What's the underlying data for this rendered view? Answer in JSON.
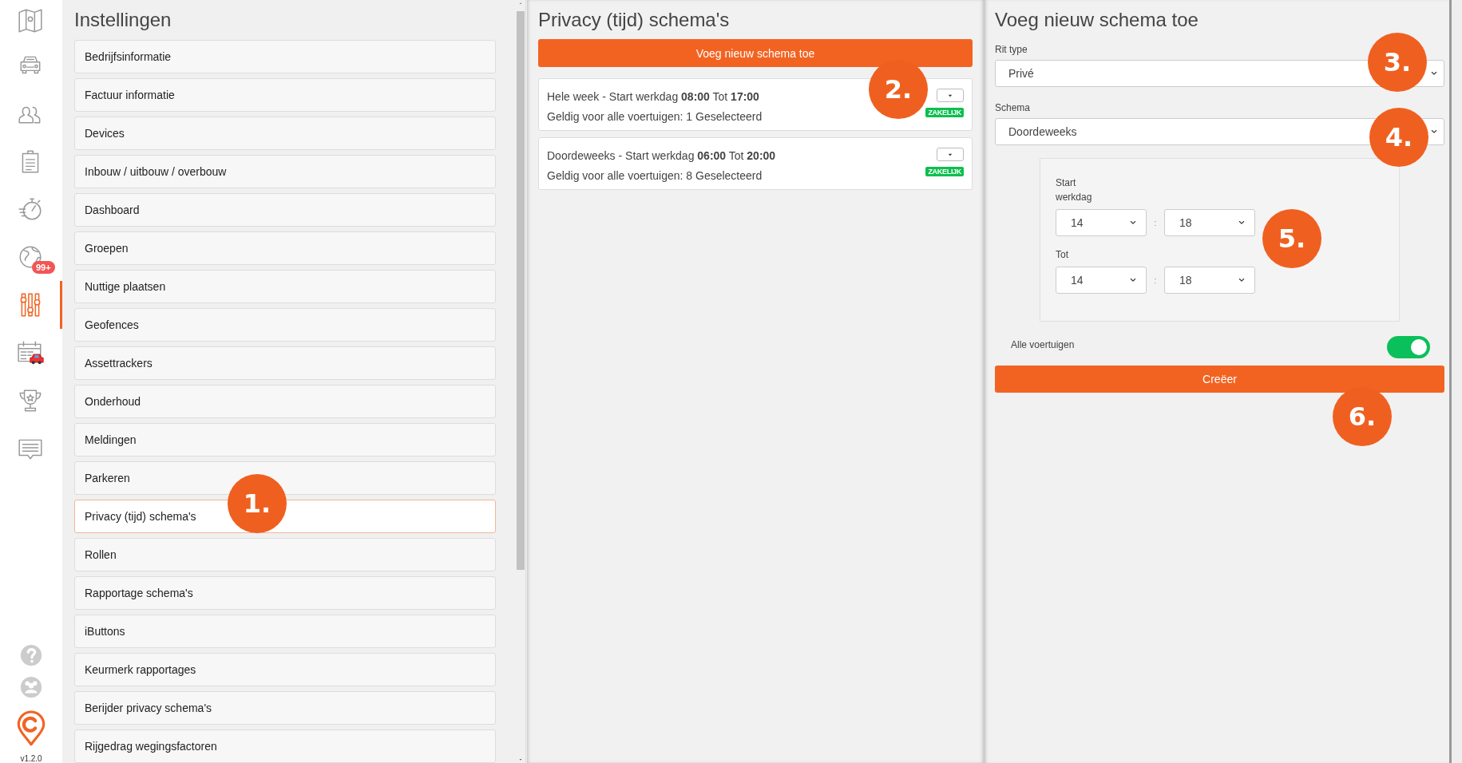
{
  "nav": {
    "items": [
      {
        "selected": false
      },
      {
        "selected": false
      },
      {
        "selected": false
      },
      {
        "selected": false
      },
      {
        "selected": false
      },
      {
        "selected": false,
        "badge": "99+"
      },
      {
        "selected": true
      },
      {
        "selected": false
      },
      {
        "selected": false
      },
      {
        "selected": false
      }
    ],
    "version": "v1.2.0"
  },
  "settings": {
    "title": "Instellingen",
    "items": [
      {
        "label": "Bedrijfsinformatie",
        "selected": false
      },
      {
        "label": "Factuur informatie",
        "selected": false
      },
      {
        "label": "Devices",
        "selected": false
      },
      {
        "label": "Inbouw / uitbouw / overbouw",
        "selected": false
      },
      {
        "label": "Dashboard",
        "selected": false
      },
      {
        "label": "Groepen",
        "selected": false
      },
      {
        "label": "Nuttige plaatsen",
        "selected": false
      },
      {
        "label": "Geofences",
        "selected": false
      },
      {
        "label": "Assettrackers",
        "selected": false
      },
      {
        "label": "Onderhoud",
        "selected": false
      },
      {
        "label": "Meldingen",
        "selected": false
      },
      {
        "label": "Parkeren",
        "selected": false
      },
      {
        "label": "Privacy (tijd) schema's",
        "selected": true
      },
      {
        "label": "Rollen",
        "selected": false
      },
      {
        "label": "Rapportage schema's",
        "selected": false
      },
      {
        "label": "iButtons",
        "selected": false
      },
      {
        "label": "Keurmerk rapportages",
        "selected": false
      },
      {
        "label": "Berijder privacy schema's",
        "selected": false
      },
      {
        "label": "Rijgedrag wegingsfactoren",
        "selected": false
      }
    ]
  },
  "schedules": {
    "title": "Privacy (tijd) schema's",
    "add_button": "Voeg nieuw schema toe",
    "cards": [
      {
        "line1": "Hele week - Start werkdag **08:00** Tot **17:00**",
        "line2": "Geldig voor alle voertuigen: 1 Geselecteerd",
        "tag": "ZAKELIJK"
      },
      {
        "line1": "Doordeweeks - Start werkdag **06:00** Tot **20:00**",
        "line2": "Geldig voor alle voertuigen: 8 Geselecteerd",
        "tag": "ZAKELIJK"
      }
    ]
  },
  "form": {
    "title": "Voeg nieuw schema toe",
    "fields": [
      {
        "label": "Rit type",
        "value": "Privé"
      },
      {
        "label": "Schema",
        "value": "Doordeweeks"
      }
    ],
    "times": [
      {
        "label": "Start werkdag",
        "hour": "14",
        "separator": ":",
        "minute": "18"
      },
      {
        "label": "Tot",
        "hour": "14",
        "separator": ":",
        "minute": "18"
      }
    ],
    "toggle": {
      "label": "Alle voertuigen",
      "on": true
    },
    "submit": "Creëer"
  },
  "callouts": [
    {
      "label": "1."
    },
    {
      "label": "2."
    },
    {
      "label": "3."
    },
    {
      "label": "4."
    },
    {
      "label": "5."
    },
    {
      "label": "6."
    }
  ]
}
